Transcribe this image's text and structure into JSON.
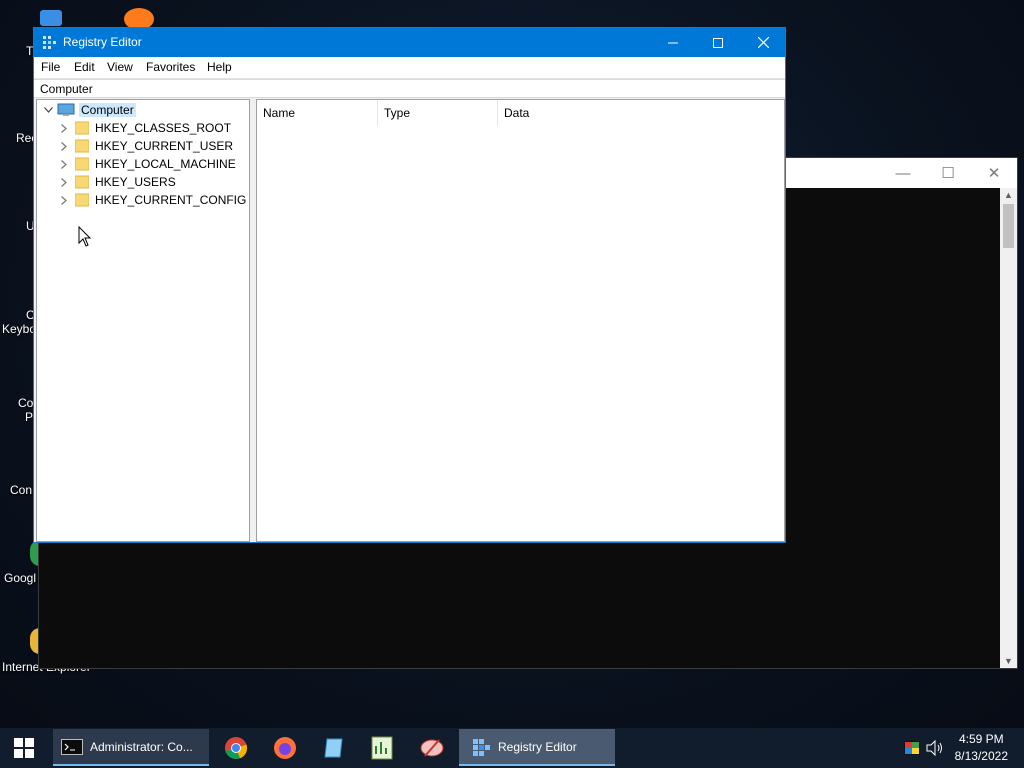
{
  "desktop": {
    "icons": [
      {
        "label": "T",
        "kind": "folder"
      },
      {
        "label": "Rec",
        "kind": "recycle"
      },
      {
        "label": "U",
        "kind": "app"
      },
      {
        "label": "C\nKeybo",
        "kind": "keyboard"
      },
      {
        "label": "Co\nP",
        "kind": "control"
      },
      {
        "label": "Con",
        "kind": "control2"
      },
      {
        "label": "Googl",
        "kind": "chrome"
      },
      {
        "label": "Internet Explorer",
        "kind": "ie"
      }
    ]
  },
  "cmd_window": {
    "title": "Administrator: Command Prompt"
  },
  "registry": {
    "title": "Registry Editor",
    "menu": [
      "File",
      "Edit",
      "View",
      "Favorites",
      "Help"
    ],
    "address": "Computer",
    "tree": {
      "root": "Computer",
      "children": [
        "HKEY_CLASSES_ROOT",
        "HKEY_CURRENT_USER",
        "HKEY_LOCAL_MACHINE",
        "HKEY_USERS",
        "HKEY_CURRENT_CONFIG"
      ]
    },
    "columns": [
      "Name",
      "Type",
      "Data"
    ]
  },
  "taskbar": {
    "tasks": [
      {
        "label": "Administrator: Co...",
        "icon": "cmd-icon"
      },
      {
        "label": "Registry Editor",
        "icon": "regedit-icon"
      }
    ],
    "pinned": [
      "chrome-icon",
      "firefox-icon",
      "notepad-icon",
      "spreadsheet-icon",
      "paint-icon"
    ],
    "time": "4:59 PM",
    "date": "8/13/2022"
  },
  "colors": {
    "titlebar": "#0078d7",
    "taskbar": "#111c2c",
    "selection": "#cce8ff"
  }
}
